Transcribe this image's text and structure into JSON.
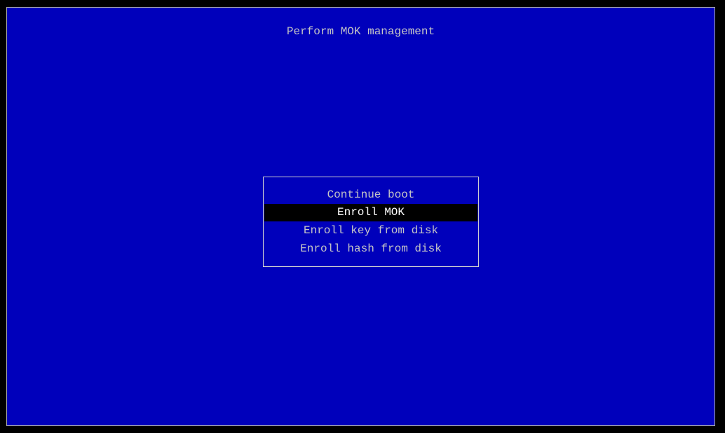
{
  "screen": {
    "title": "Perform MOK management"
  },
  "menu": {
    "items": [
      {
        "label": "Continue boot"
      },
      {
        "label": "Enroll MOK",
        "selected": true
      },
      {
        "label": "Enroll key from disk"
      },
      {
        "label": "Enroll hash from disk"
      }
    ]
  },
  "colors": {
    "background": "#0000bb",
    "text": "#c6c6c6",
    "selected_background": "#000000",
    "border": "#d0d0d0"
  }
}
